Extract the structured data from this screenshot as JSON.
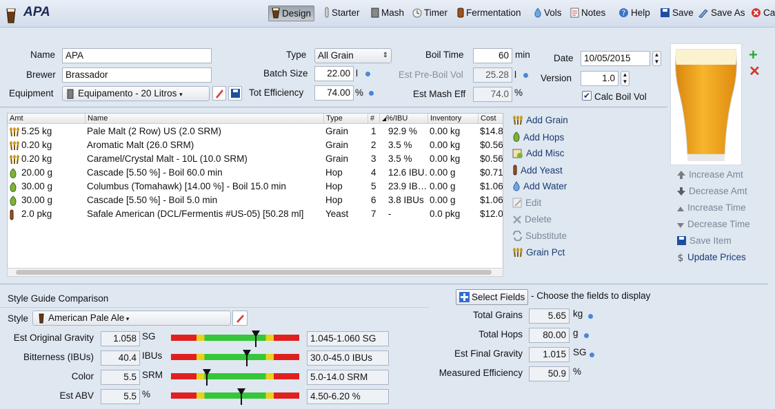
{
  "title": "APA",
  "toolbar": [
    {
      "id": "design",
      "label": "Design",
      "icon": "beer-glass-icon",
      "active": true
    },
    {
      "id": "starter",
      "label": "Starter",
      "icon": "test-tube-icon"
    },
    {
      "id": "mash",
      "label": "Mash",
      "icon": "mash-tun-icon"
    },
    {
      "id": "timer",
      "label": "Timer",
      "icon": "clock-icon"
    },
    {
      "id": "fermentation",
      "label": "Fermentation",
      "icon": "fermenter-icon"
    },
    {
      "id": "vols",
      "label": "Vols",
      "icon": "water-drop-icon"
    },
    {
      "id": "notes",
      "label": "Notes",
      "icon": "notepad-icon"
    },
    {
      "id": "help",
      "label": "Help",
      "icon": "help-icon"
    },
    {
      "id": "save",
      "label": "Save",
      "icon": "floppy-disk-icon"
    },
    {
      "id": "saveas",
      "label": "Save As",
      "icon": "pen-icon"
    },
    {
      "id": "cancel",
      "label": "Car",
      "icon": "cancel-icon"
    }
  ],
  "form": {
    "name_label": "Name",
    "name": "APA",
    "brewer_label": "Brewer",
    "brewer": "Brassador",
    "equipment_label": "Equipment",
    "equipment": "Equipamento - 20 Litros",
    "type_label": "Type",
    "type": "All Grain",
    "batch_label": "Batch Size",
    "batch": "22.00",
    "batch_unit": "l",
    "eff_label": "Tot Efficiency",
    "eff": "74.00",
    "eff_unit": "%",
    "boil_label": "Boil Time",
    "boil": "60",
    "boil_unit": "min",
    "preboil_label": "Est Pre-Boil Vol",
    "preboil": "25.28",
    "preboil_unit": "l",
    "masheff_label": "Est Mash Eff",
    "masheff": "74.0",
    "masheff_unit": "%",
    "date_label": "Date",
    "date": "10/05/2015",
    "version_label": "Version",
    "version": "1.0",
    "calc_label": "Calc Boil Vol",
    "calc_checked": true
  },
  "table": {
    "headers": [
      "Amt",
      "Name",
      "Type",
      "#",
      "%/IBU",
      "Inventory",
      "Cost"
    ],
    "rows": [
      {
        "icon": "grain-icon",
        "amt": "5.25 kg",
        "name": "Pale Malt (2 Row) US (2.0 SRM)",
        "type": "Grain",
        "num": "1",
        "pct": "92.9 %",
        "inv": "0.00 kg",
        "cost": "$14.8"
      },
      {
        "icon": "grain-icon",
        "amt": "0.20 kg",
        "name": "Aromatic Malt (26.0 SRM)",
        "type": "Grain",
        "num": "2",
        "pct": "3.5 %",
        "inv": "0.00 kg",
        "cost": "$0.56"
      },
      {
        "icon": "grain-icon",
        "amt": "0.20 kg",
        "name": "Caramel/Crystal Malt - 10L (10.0 SRM)",
        "type": "Grain",
        "num": "3",
        "pct": "3.5 %",
        "inv": "0.00 kg",
        "cost": "$0.56"
      },
      {
        "icon": "hop-icon",
        "amt": "20.00 g",
        "name": "Cascade [5.50 %] - Boil 60.0 min",
        "type": "Hop",
        "num": "4",
        "pct": "12.6 IBU…",
        "inv": "0.00 g",
        "cost": "$0.71"
      },
      {
        "icon": "hop-icon",
        "amt": "30.00 g",
        "name": "Columbus (Tomahawk) [14.00 %] - Boil 15.0 min",
        "type": "Hop",
        "num": "5",
        "pct": "23.9 IB…",
        "inv": "0.00 g",
        "cost": "$1.06"
      },
      {
        "icon": "hop-icon",
        "amt": "30.00 g",
        "name": "Cascade [5.50 %] - Boil 5.0 min",
        "type": "Hop",
        "num": "6",
        "pct": "3.8 IBUs",
        "inv": "0.00 g",
        "cost": "$1.06"
      },
      {
        "icon": "yeast-icon",
        "amt": "2.0 pkg",
        "name": "Safale American  (DCL/Fermentis #US-05) [50.28 ml]",
        "type": "Yeast",
        "num": "7",
        "pct": "-",
        "inv": "0.0 pkg",
        "cost": "$12.0"
      }
    ]
  },
  "actions": [
    {
      "label": "Add Grain",
      "icon": "grain-icon",
      "enabled": true
    },
    {
      "label": "Add Hops",
      "icon": "hop-icon",
      "enabled": true
    },
    {
      "label": "Add Misc",
      "icon": "misc-icon",
      "enabled": true
    },
    {
      "label": "Add Yeast",
      "icon": "yeast-icon",
      "enabled": true
    },
    {
      "label": "Add Water",
      "icon": "water-drop-icon",
      "enabled": true
    },
    {
      "label": "Edit",
      "icon": "edit-icon",
      "enabled": false
    },
    {
      "label": "Delete",
      "icon": "delete-icon",
      "enabled": false
    },
    {
      "label": "Substitute",
      "icon": "substitute-icon",
      "enabled": false
    },
    {
      "label": "Grain Pct",
      "icon": "grain-icon",
      "enabled": true
    }
  ],
  "side_actions": [
    {
      "label": "Increase Amt",
      "icon": "arrow-up-icon"
    },
    {
      "label": "Decrease Amt",
      "icon": "arrow-down-icon"
    },
    {
      "label": "Increase Time",
      "icon": "triangle-up-icon"
    },
    {
      "label": "Decrease Time",
      "icon": "triangle-down-icon"
    },
    {
      "label": "Save Item",
      "icon": "floppy-disk-icon"
    },
    {
      "label": "Update Prices",
      "icon": "dollar-icon"
    }
  ],
  "style": {
    "section_title": "Style Guide Comparison",
    "style_label": "Style",
    "style": "American Pale Ale",
    "rows": [
      {
        "label": "Est Original Gravity",
        "value": "1.058",
        "unit": "SG",
        "range": "1.045-1.060 SG",
        "marker": 0.66
      },
      {
        "label": "Bitterness (IBUs)",
        "value": "40.4",
        "unit": "IBUs",
        "range": "30.0-45.0 IBUs",
        "marker": 0.59
      },
      {
        "label": "Color",
        "value": "5.5",
        "unit": "SRM",
        "range": "5.0-14.0 SRM",
        "marker": 0.28
      },
      {
        "label": "Est ABV",
        "value": "5.5",
        "unit": "%",
        "range": "4.50-6.20 %",
        "marker": 0.55
      }
    ]
  },
  "fields": {
    "select_label": "Select Fields",
    "select_hint": "- Choose the fields to display",
    "rows": [
      {
        "label": "Total Grains",
        "value": "5.65",
        "unit": "kg"
      },
      {
        "label": "Total Hops",
        "value": "80.00",
        "unit": "g"
      },
      {
        "label": "Est Final Gravity",
        "value": "1.015",
        "unit": "SG"
      },
      {
        "label": "Measured Efficiency",
        "value": "50.9",
        "unit": "%"
      }
    ]
  },
  "colors": {
    "accent": "#4b86d6",
    "beer": "#f0a21c",
    "add": "#2ea83a",
    "remove": "#d9332b"
  }
}
